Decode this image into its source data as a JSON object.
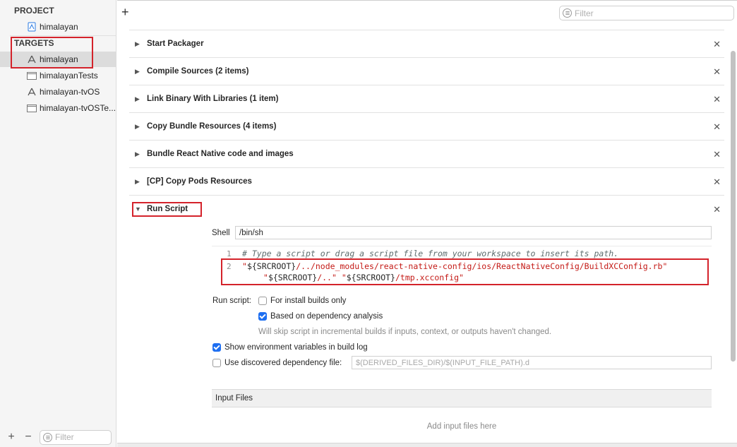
{
  "sidebar": {
    "project_header": "PROJECT",
    "project_item": "himalayan",
    "targets_header": "TARGETS",
    "targets": [
      {
        "label": "himalayan",
        "icon": "app-target-icon"
      },
      {
        "label": "himalayanTests",
        "icon": "test-bundle-icon"
      },
      {
        "label": "himalayan-tvOS",
        "icon": "app-target-icon"
      },
      {
        "label": "himalayan-tvOSTe...",
        "icon": "test-bundle-icon"
      }
    ],
    "filter_placeholder": "Filter"
  },
  "toolbar": {
    "add_label": "+",
    "filter_placeholder": "Filter"
  },
  "phases": [
    {
      "title": "Start Packager"
    },
    {
      "title": "Compile Sources (2 items)"
    },
    {
      "title": "Link Binary With Libraries (1 item)"
    },
    {
      "title": "Copy Bundle Resources (4 items)"
    },
    {
      "title": "Bundle React Native code and images"
    },
    {
      "title": "[CP] Copy Pods Resources"
    },
    {
      "title": "Run Script"
    }
  ],
  "run_script": {
    "shell_label": "Shell",
    "shell_value": "/bin/sh",
    "line1_no": "1",
    "line2_no": "2",
    "comment": "# Type a script or drag a script file from your workspace to insert its path.",
    "line2_q1": "\"",
    "line2_var1": "${SRCROOT}",
    "line2_path1": "/../node_modules/react-native-config/ios/ReactNativeConfig/BuildXCConfig.rb\"",
    "line3_q1": "\"",
    "line3_var2": "${SRCROOT}",
    "line3_path2": "/..\" ",
    "line3_q2": "\"",
    "line3_var3": "${SRCROOT}",
    "line3_path3": "/tmp.xcconfig\"",
    "run_script_label": "Run script:",
    "opt_install_builds": "For install builds only",
    "opt_dependency": "Based on dependency analysis",
    "dependency_note": "Will skip script in incremental builds if inputs, context, or outputs haven't changed.",
    "opt_show_env": "Show environment variables in build log",
    "opt_dep_file": "Use discovered dependency file:",
    "dep_file_placeholder": "$(DERIVED_FILES_DIR)/$(INPUT_FILE_PATH).d",
    "input_files_header": "Input Files",
    "input_files_empty": "Add input files here"
  },
  "checkbox_states": {
    "install_builds": false,
    "dependency_analysis": true,
    "show_env": true,
    "dep_file": false
  },
  "colors": {
    "annotation_red": "#d4232b",
    "checkbox_blue": "#1e6ff1",
    "string_red": "#c41a16"
  }
}
